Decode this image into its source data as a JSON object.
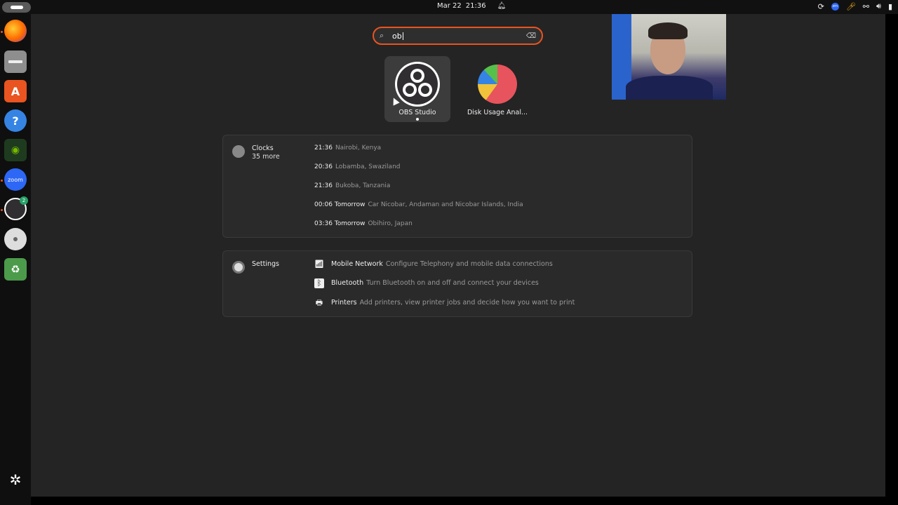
{
  "topbar": {
    "date": "Mar 22",
    "time": "21:36"
  },
  "search": {
    "value": "ob"
  },
  "apps": [
    {
      "name": "OBS Studio"
    },
    {
      "name": "Disk Usage Anal..."
    }
  ],
  "clocks": {
    "title": "Clocks",
    "more": "35 more",
    "rows": [
      {
        "time": "21:36",
        "place": "Nairobi, Kenya"
      },
      {
        "time": "20:36",
        "place": "Lobamba, Swaziland"
      },
      {
        "time": "21:36",
        "place": "Bukoba, Tanzania"
      },
      {
        "time": "00:06 Tomorrow",
        "place": "Car Nicobar, Andaman and Nicobar Islands, India"
      },
      {
        "time": "03:36 Tomorrow",
        "place": "Obihiro, Japan"
      }
    ]
  },
  "settings": {
    "title": "Settings",
    "rows": [
      {
        "name": "Mobile Network",
        "desc": "Configure Telephony and mobile data connections",
        "icon": "antenna-icon"
      },
      {
        "name": "Bluetooth",
        "desc": "Turn Bluetooth on and off and connect your devices",
        "icon": "bluetooth-icon"
      },
      {
        "name": "Printers",
        "desc": "Add printers, view printer jobs and decide how you want to print",
        "icon": "printer-icon"
      }
    ]
  },
  "dock": {
    "zoom_label": "zoom",
    "obs_badge": "2"
  },
  "colors": {
    "accent": "#e95420",
    "background": "#242424",
    "panel": "#2a2a2a"
  }
}
